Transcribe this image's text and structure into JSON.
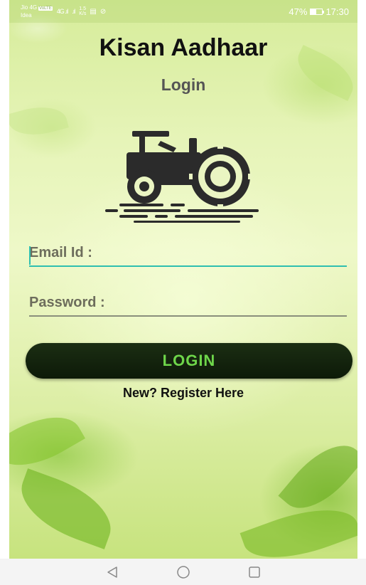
{
  "statusbar": {
    "carrier_line1": "Jio 4G",
    "carrier_line2": "Idea",
    "volte": "VoLTE",
    "signal1": "4G .ıl",
    "signal2": ".ıl",
    "speed_value": "1.5",
    "speed_unit": "K/s",
    "battery_percent_text": "47%",
    "battery_level": 0.47,
    "time": "17:30"
  },
  "app": {
    "title": "Kisan Aadhaar",
    "page_title": "Login"
  },
  "form": {
    "email_placeholder": "Email Id :",
    "email_value": "",
    "password_placeholder": "Password :",
    "password_value": "",
    "login_label": "LOGIN",
    "register_link": "New? Register Here"
  },
  "icons": {
    "logo": "tractor-icon",
    "back": "back-triangle-icon",
    "home": "home-circle-icon",
    "recents": "recents-square-icon"
  },
  "colors": {
    "accent": "#2fbfb0",
    "button_bg": "#142410",
    "button_text": "#6ed64a"
  }
}
